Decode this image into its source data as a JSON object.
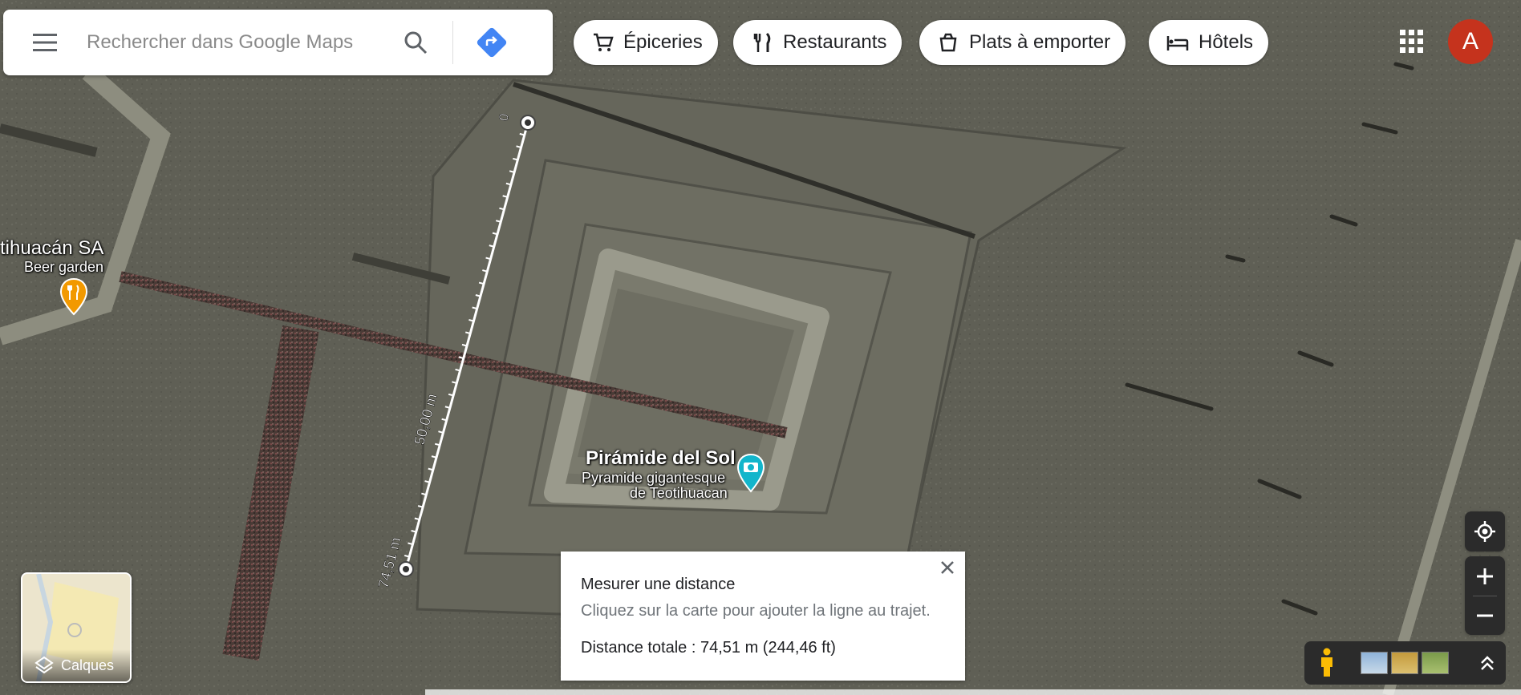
{
  "search": {
    "placeholder": "Rechercher dans Google Maps"
  },
  "chips": [
    {
      "label": "Épiceries",
      "icon": "cart-icon"
    },
    {
      "label": "Restaurants",
      "icon": "fork-knife-icon"
    },
    {
      "label": "Plats à emporter",
      "icon": "takeout-icon"
    },
    {
      "label": "Hôtels",
      "icon": "bed-icon"
    }
  ],
  "account": {
    "avatar_letter": "A",
    "avatar_color": "#c5331d"
  },
  "map": {
    "places": [
      {
        "name": "tihuacán SA",
        "category": "Beer garden",
        "icon": "restaurant-pin-icon"
      },
      {
        "name": "Pirámide del Sol",
        "description_line1": "Pyramide gigantesque",
        "description_line2": "de Teotihuacan",
        "icon": "camera-pin-icon"
      }
    ],
    "ruler": {
      "start_label": "0",
      "mid_label": "50,00 m",
      "end_label": "74,51 m"
    }
  },
  "measure_panel": {
    "title": "Mesurer une distance",
    "hint": "Cliquez sur la carte pour ajouter la ligne au trajet.",
    "total": "Distance totale : 74,51 m (244,46 ft)"
  },
  "layers": {
    "label": "Calques"
  },
  "colors": {
    "accent": "#4285f4",
    "avatar": "#c5331d",
    "restaurant_pin": "#f29900",
    "attraction_pin": "#12b5cb"
  }
}
